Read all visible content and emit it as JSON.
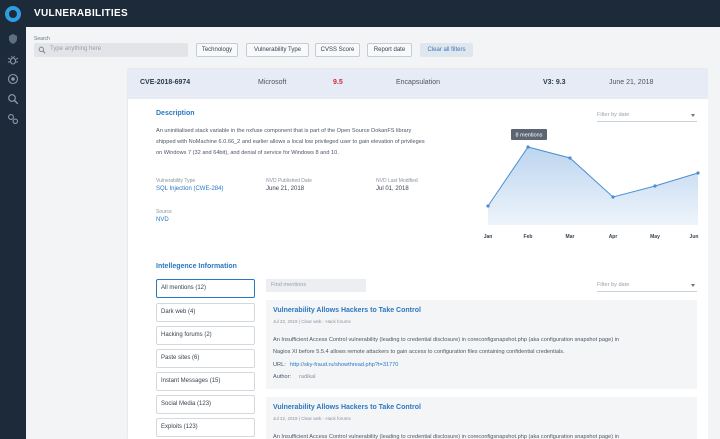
{
  "header": {
    "title": "VULNERABILITIES"
  },
  "sidebar": {
    "icons": [
      "logo-icon",
      "shield-icon",
      "bug-icon",
      "target-icon",
      "search-icon",
      "settings-icon"
    ]
  },
  "search": {
    "label": "Search",
    "placeholder": "Type anything here"
  },
  "filters": [
    "Technology",
    "Vulnerability Type",
    "CVSS Score",
    "Report date",
    "Clear all filters"
  ],
  "cve": {
    "id": "CVE-2018-6974",
    "vendor": "Microsoft",
    "score": "9.5",
    "category": "Encapsulation",
    "v3": "V3: 9.3",
    "date": "June 21, 2018"
  },
  "description": {
    "title": "Description",
    "lines": [
      "An uninitialised stack variable in the nxfuse component that is part of the Open Source DokanFS library",
      "shipped with NoMachine 6.0.66_2 and earlier allows a local low privileged user to gain elevation of privileges",
      "on Windows 7 (32 and 64bit), and denial of service for Windows 8 and 10."
    ],
    "filter_placeholder": "Filter by date"
  },
  "meta": {
    "vuln_type_label": "Vulnerability Type",
    "vuln_type": "SQL Injection (CWE-284)",
    "published_label": "NVD Published Date",
    "published": "June 21, 2018",
    "modified_label": "NVD Last Modified",
    "modified": "Jul 01, 2018",
    "source_label": "Source",
    "source": "NVD"
  },
  "chart_data": {
    "type": "area",
    "categories": [
      "Jan",
      "Feb",
      "Mar",
      "Apr",
      "May",
      "Jun"
    ],
    "tooltip": "8 mentions",
    "color": "#4a8fd4"
  },
  "intelligence": {
    "title": "Intellegence Information",
    "find_placeholder": "Find mentions",
    "filter_placeholder": "Filter by date",
    "categories": [
      "All mentions (12)",
      "Dark web (4)",
      "Hacking forums (2)",
      "Paste sites (6)",
      "Instant Messages (15)",
      "Social Media (123)",
      "Exploits (123)"
    ],
    "mentions": [
      {
        "title": "Vulnerability Allows Hackers to Take Control",
        "meta": "Jul 22, 2019 | Clear web · Hack forums",
        "body": [
          "An Insufficient Access Control vulnerability (leading to credential disclosure) in coreconfigsnapshot.php (aka configuration snapshot page) in",
          "Nagios XI before 5.5.4 allows remote attackers to gain access to configuration files containing confidential credentials."
        ],
        "url_label": "URL:",
        "url": "http://sky-fraud.ru/showthread.php?t=31770",
        "author_label": "Author:",
        "author": "radikal"
      },
      {
        "title": "Vulnerability Allows Hackers to Take Control",
        "meta": "Jul 22, 2019 | Clear web · Hack forums",
        "body": [
          "An Insufficient Access Control vulnerability (leading to credential disclosure) in coreconfigsnapshot.php (aka configuration snapshot page) in"
        ]
      }
    ]
  }
}
